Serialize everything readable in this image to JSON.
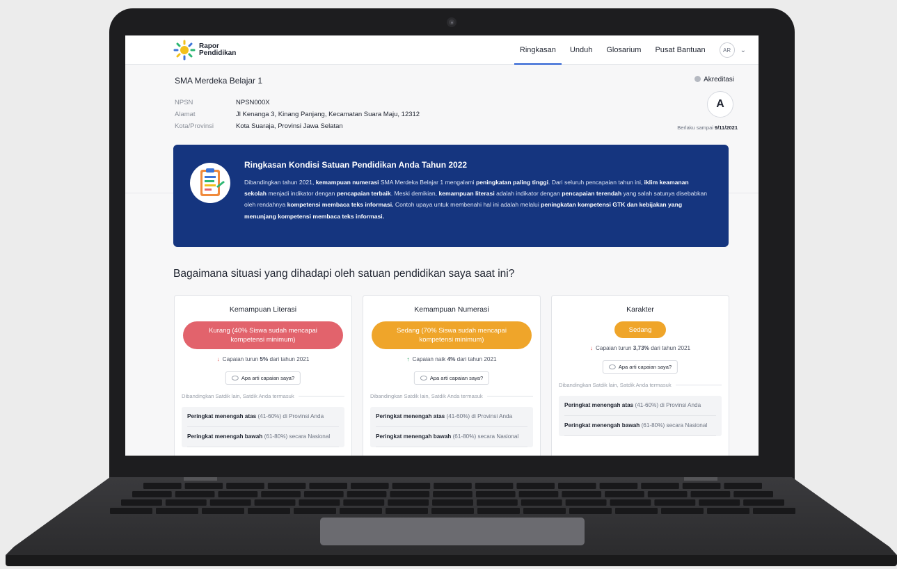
{
  "app": {
    "logo_line1": "Rapor",
    "logo_line2": "Pendidikan"
  },
  "nav": {
    "items": [
      {
        "label": "Ringkasan",
        "active": true
      },
      {
        "label": "Unduh"
      },
      {
        "label": "Glosarium"
      },
      {
        "label": "Pusat Bantuan"
      }
    ],
    "avatar_initials": "AR"
  },
  "school": {
    "name": "SMA Merdeka Belajar 1",
    "fields": [
      {
        "label": "NPSN",
        "value": "NPSN000X"
      },
      {
        "label": "Alamat",
        "value": "Jl Kenanga 3, Kinang Panjang, Kecamatan Suara Maju, 12312"
      },
      {
        "label": "Kota/Provinsi",
        "value": "Kota Suaraja, Provinsi Jawa Selatan"
      }
    ]
  },
  "accreditation": {
    "label": "Akreditasi",
    "grade": "A",
    "valid_prefix": "Berlaku sampai",
    "valid_date": "9/11/2021"
  },
  "summary": {
    "title": "Ringkasan Kondisi Satuan Pendidikan Anda Tahun 2022",
    "segments": [
      {
        "t": "Dibandingkan tahun 2021, "
      },
      {
        "t": "kemampuan numerasi",
        "b": true
      },
      {
        "t": " SMA Merdeka Belajar 1 mengalami "
      },
      {
        "t": "peningkatan paling tinggi",
        "b": true
      },
      {
        "t": ". Dari seluruh pencapaian tahun ini, "
      },
      {
        "t": "iklim keamanan sekolah",
        "b": true
      },
      {
        "t": " menjadi indikator dengan "
      },
      {
        "t": "pencapaian terbaik",
        "b": true
      },
      {
        "t": ". Meski demikian, "
      },
      {
        "t": "kemampuan literasi",
        "b": true
      },
      {
        "t": " adalah indikator dengan "
      },
      {
        "t": "pencapaian terendah",
        "b": true
      },
      {
        "t": " yang salah satunya disebabkan oleh rendahnya "
      },
      {
        "t": "kompetensi membaca teks informasi.",
        "b": true
      },
      {
        "t": " Contoh upaya untuk membenahi hal ini adalah melalui "
      },
      {
        "t": "peningkatan kompetensi GTK dan kebijakan yang menunjang kompetensi membaca teks informasi.",
        "b": true
      }
    ]
  },
  "question": "Bagaimana situasi yang dihadapi oleh satuan pendidikan saya saat ini?",
  "colors": {
    "red": "#e2636c",
    "orange": "#efa52a",
    "navy": "#15357f",
    "accent": "#2a5fd3"
  },
  "cards": [
    {
      "title": "Kemampuan Literasi",
      "status": "Kurang (40% Siswa sudah mencapai kompetensi minimum)",
      "status_color": "#e2636c",
      "direction": "down",
      "change_prefix": "Capaian turun ",
      "change_value": "5%",
      "change_suffix": " dari tahun 2021",
      "help": "Apa arti capaian saya?",
      "compare_label": "Dibandingkan Satdik lain, Satdik Anda termasuk",
      "ranks": [
        {
          "bold": "Peringkat menengah atas",
          "rest": " (41-60%) di Provinsi Anda"
        },
        {
          "bold": "Peringkat menengah bawah",
          "rest": " (61-80%) secara Nasional"
        }
      ]
    },
    {
      "title": "Kemampuan Numerasi",
      "status": "Sedang (70% Siswa sudah mencapai kompetensi minimum)",
      "status_color": "#efa52a",
      "direction": "up",
      "change_prefix": "Capaian naik ",
      "change_value": "4%",
      "change_suffix": " dari tahun 2021",
      "help": "Apa arti capaian saya?",
      "compare_label": "Dibandingkan Satdik lain, Satdik Anda termasuk",
      "ranks": [
        {
          "bold": "Peringkat menengah atas",
          "rest": " (41-60%) di Provinsi Anda"
        },
        {
          "bold": "Peringkat menengah bawah",
          "rest": " (61-80%) secara Nasional"
        }
      ]
    },
    {
      "title": "Karakter",
      "status": "Sedang",
      "status_color": "#efa52a",
      "direction": "down",
      "change_prefix": "Capaian turun ",
      "change_value": "3,73%",
      "change_suffix": " dari tahun 2021",
      "help": "Apa arti capaian saya?",
      "compare_label": "Dibandingkan Satdik lain, Satdik Anda termasuk",
      "ranks": [
        {
          "bold": "Peringkat menengah atas",
          "rest": " (41-60%) di Provinsi Anda"
        },
        {
          "bold": "Peringkat menengah bawah",
          "rest": " (61-80%) secara Nasional"
        }
      ]
    }
  ]
}
